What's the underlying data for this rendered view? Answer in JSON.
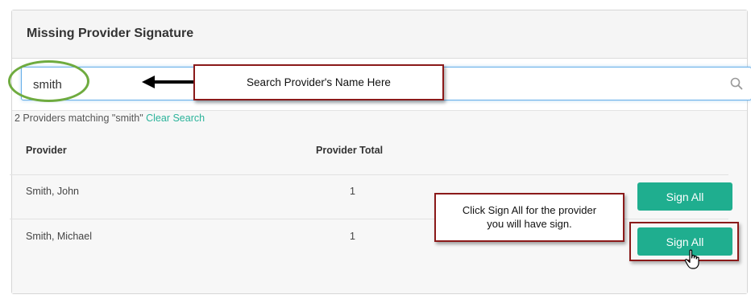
{
  "panel": {
    "title": "Missing Provider Signature"
  },
  "search": {
    "value": "smith",
    "icon": "search-icon"
  },
  "results": {
    "summary": "2 Providers matching \"smith\"",
    "clear_label": "Clear Search",
    "headers": {
      "provider": "Provider",
      "total": "Provider Total"
    },
    "rows": [
      {
        "provider": "Smith, John",
        "total": "1",
        "action": "Sign All"
      },
      {
        "provider": "Smith, Michael",
        "total": "1",
        "action": "Sign All"
      }
    ]
  },
  "annotations": {
    "search_callout": "Search Provider's Name Here",
    "sign_callout_line1": "Click Sign All for the provider",
    "sign_callout_line2": "you will have sign."
  },
  "colors": {
    "accent": "#1fae8f",
    "link": "#2bb39a",
    "callout_border": "#8b1a1a",
    "oval": "#6fab3f"
  }
}
